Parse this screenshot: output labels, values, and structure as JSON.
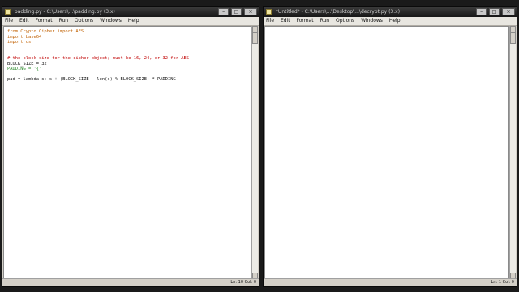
{
  "left_window": {
    "title": "padding.py - C:\\Users\\...\\padding.py (3.x)",
    "menu": [
      "File",
      "Edit",
      "Format",
      "Run",
      "Options",
      "Windows",
      "Help"
    ],
    "code": [
      "from Crypto.Cipher import AES",
      "import base64",
      "import os",
      "",
      "",
      "# the block size for the cipher object; must be 16, 24, or 32 for AES",
      "BLOCK_SIZE = 32",
      "PADDING = '{'",
      "",
      "pad = lambda s: s + (BLOCK_SIZE - len(s) % BLOCK_SIZE) * PADDING"
    ],
    "status": "Ln: 10 Col: 0"
  },
  "right_window": {
    "title": "*Untitled* - C:\\Users\\...\\Desktop\\...\\decrypt.py (3.x)",
    "menu": [
      "File",
      "Edit",
      "Format",
      "Run",
      "Options",
      "Windows",
      "Help"
    ],
    "status": "Ln: 1 Col: 0"
  },
  "window_buttons": {
    "minimize": "–",
    "maximize": "□",
    "close": "×"
  }
}
